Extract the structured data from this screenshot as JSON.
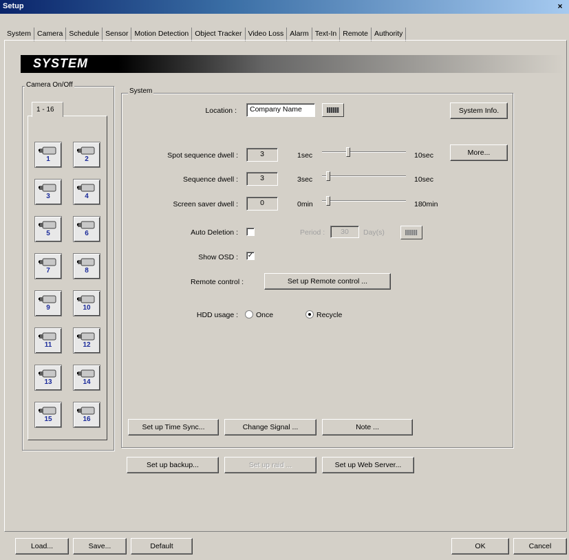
{
  "window": {
    "title": "Setup",
    "close": "×"
  },
  "tabs": [
    "System",
    "Camera",
    "Schedule",
    "Sensor",
    "Motion Detection",
    "Object Tracker",
    "Video Loss",
    "Alarm",
    "Text-In",
    "Remote",
    "Authority"
  ],
  "header": {
    "title": "SYSTEM"
  },
  "camera_group": {
    "legend": "Camera On/Off",
    "subtab": "1 - 16",
    "cameras": [
      "1",
      "2",
      "3",
      "4",
      "5",
      "6",
      "7",
      "8",
      "9",
      "10",
      "11",
      "12",
      "13",
      "14",
      "15",
      "16"
    ]
  },
  "system_group": {
    "legend": "System",
    "location_label": "Location :",
    "location_value": "Company Name",
    "system_info_button": "System Info.",
    "spot_dwell_label": "Spot sequence dwell :",
    "spot_dwell_value": "3",
    "spot_dwell_min": "1sec",
    "spot_dwell_max": "10sec",
    "spot_dwell_level": 0.25,
    "more_button": "More...",
    "seq_dwell_label": "Sequence dwell :",
    "seq_dwell_value": "3",
    "seq_dwell_min": "3sec",
    "seq_dwell_max": "10sec",
    "seq_dwell_level": 0.0,
    "saver_dwell_label": "Screen saver dwell :",
    "saver_dwell_value": "0",
    "saver_dwell_min": "0min",
    "saver_dwell_max": "180min",
    "saver_dwell_level": 0.0,
    "auto_deletion_label": "Auto Deletion :",
    "auto_deletion_checked": false,
    "period_label": "Period :",
    "period_value": "30",
    "period_unit": "Day(s)",
    "show_osd_label": "Show OSD :",
    "show_osd_checked": true,
    "remote_control_label": "Remote control :",
    "remote_control_button": "Set up Remote control ...",
    "hdd_usage_label": "HDD usage :",
    "hdd_once": "Once",
    "hdd_recycle": "Recycle",
    "hdd_selected": "Recycle",
    "time_sync_button": "Set up Time Sync...",
    "change_signal_button": "Change Signal ...",
    "note_button": "Note ..."
  },
  "lower_buttons": {
    "backup": "Set up backup...",
    "raid": "Set up raid ...",
    "web_server": "Set up Web Server..."
  },
  "footer": {
    "load": "Load...",
    "save": "Save...",
    "default": "Default",
    "ok": "OK",
    "cancel": "Cancel"
  },
  "check_mark": "✓"
}
